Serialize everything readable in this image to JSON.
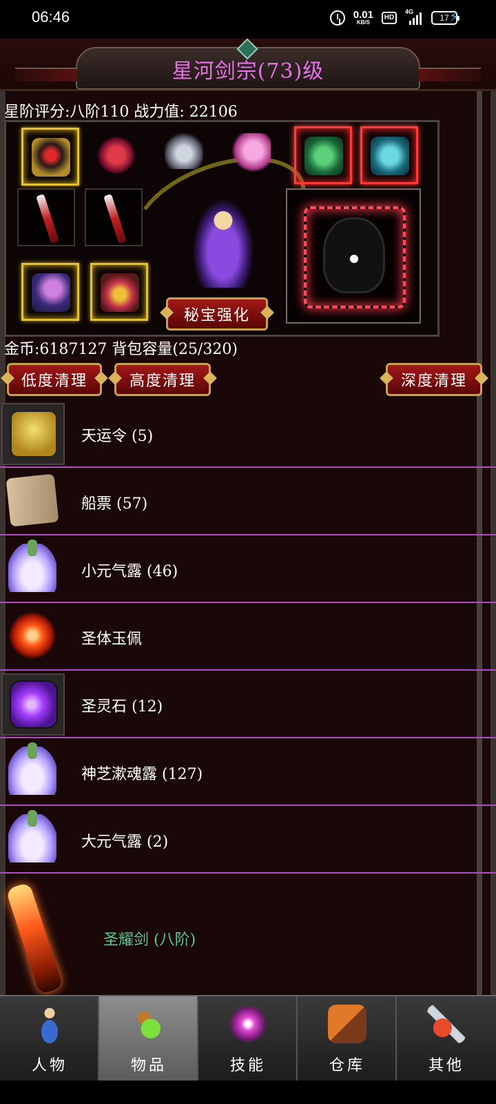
{
  "status_bar": {
    "time": "06:46",
    "speed_value": "0.01",
    "speed_unit": "KB/S",
    "hd": "HD",
    "network": "4G",
    "battery": "17"
  },
  "header": {
    "title": "星河剑宗(73)级"
  },
  "stats": {
    "line": "星阶评分:八阶110 战力值: 22106"
  },
  "equipment": {
    "secret_enhance_label": "秘宝强化"
  },
  "inventory": {
    "gold_line": "金币:6187127 背包容量(25/320)",
    "clean_low_label": "低度清理",
    "clean_high_label": "高度清理",
    "clean_deep_label": "深度清理",
    "items": [
      {
        "name": "天运令 (5)",
        "icon": "token-icon"
      },
      {
        "name": "船票 (57)",
        "icon": "scroll-icon"
      },
      {
        "name": "小元气露 (46)",
        "icon": "potion-icon"
      },
      {
        "name": "圣体玉佩",
        "icon": "sun-jade-icon"
      },
      {
        "name": "圣灵石 (12)",
        "icon": "purple-stone-icon"
      },
      {
        "name": "神芝漱魂露 (127)",
        "icon": "potion-icon"
      },
      {
        "name": "大元气露 (2)",
        "icon": "potion-icon"
      },
      {
        "name": "圣耀剑 (八阶)",
        "icon": "sword-icon",
        "color": "#59c98c"
      }
    ]
  },
  "nav": {
    "tabs": [
      {
        "label": "人物",
        "icon": "person-icon"
      },
      {
        "label": "物品",
        "icon": "item-bag-icon",
        "active": true
      },
      {
        "label": "技能",
        "icon": "skill-orb-icon"
      },
      {
        "label": "仓库",
        "icon": "warehouse-icon"
      },
      {
        "label": "其他",
        "icon": "other-icon"
      }
    ]
  },
  "colors": {
    "title": "#e870e8",
    "divider": "#b04cc8",
    "button": "#a31818",
    "button_border": "#c8a24a",
    "special_item": "#59c98c"
  }
}
